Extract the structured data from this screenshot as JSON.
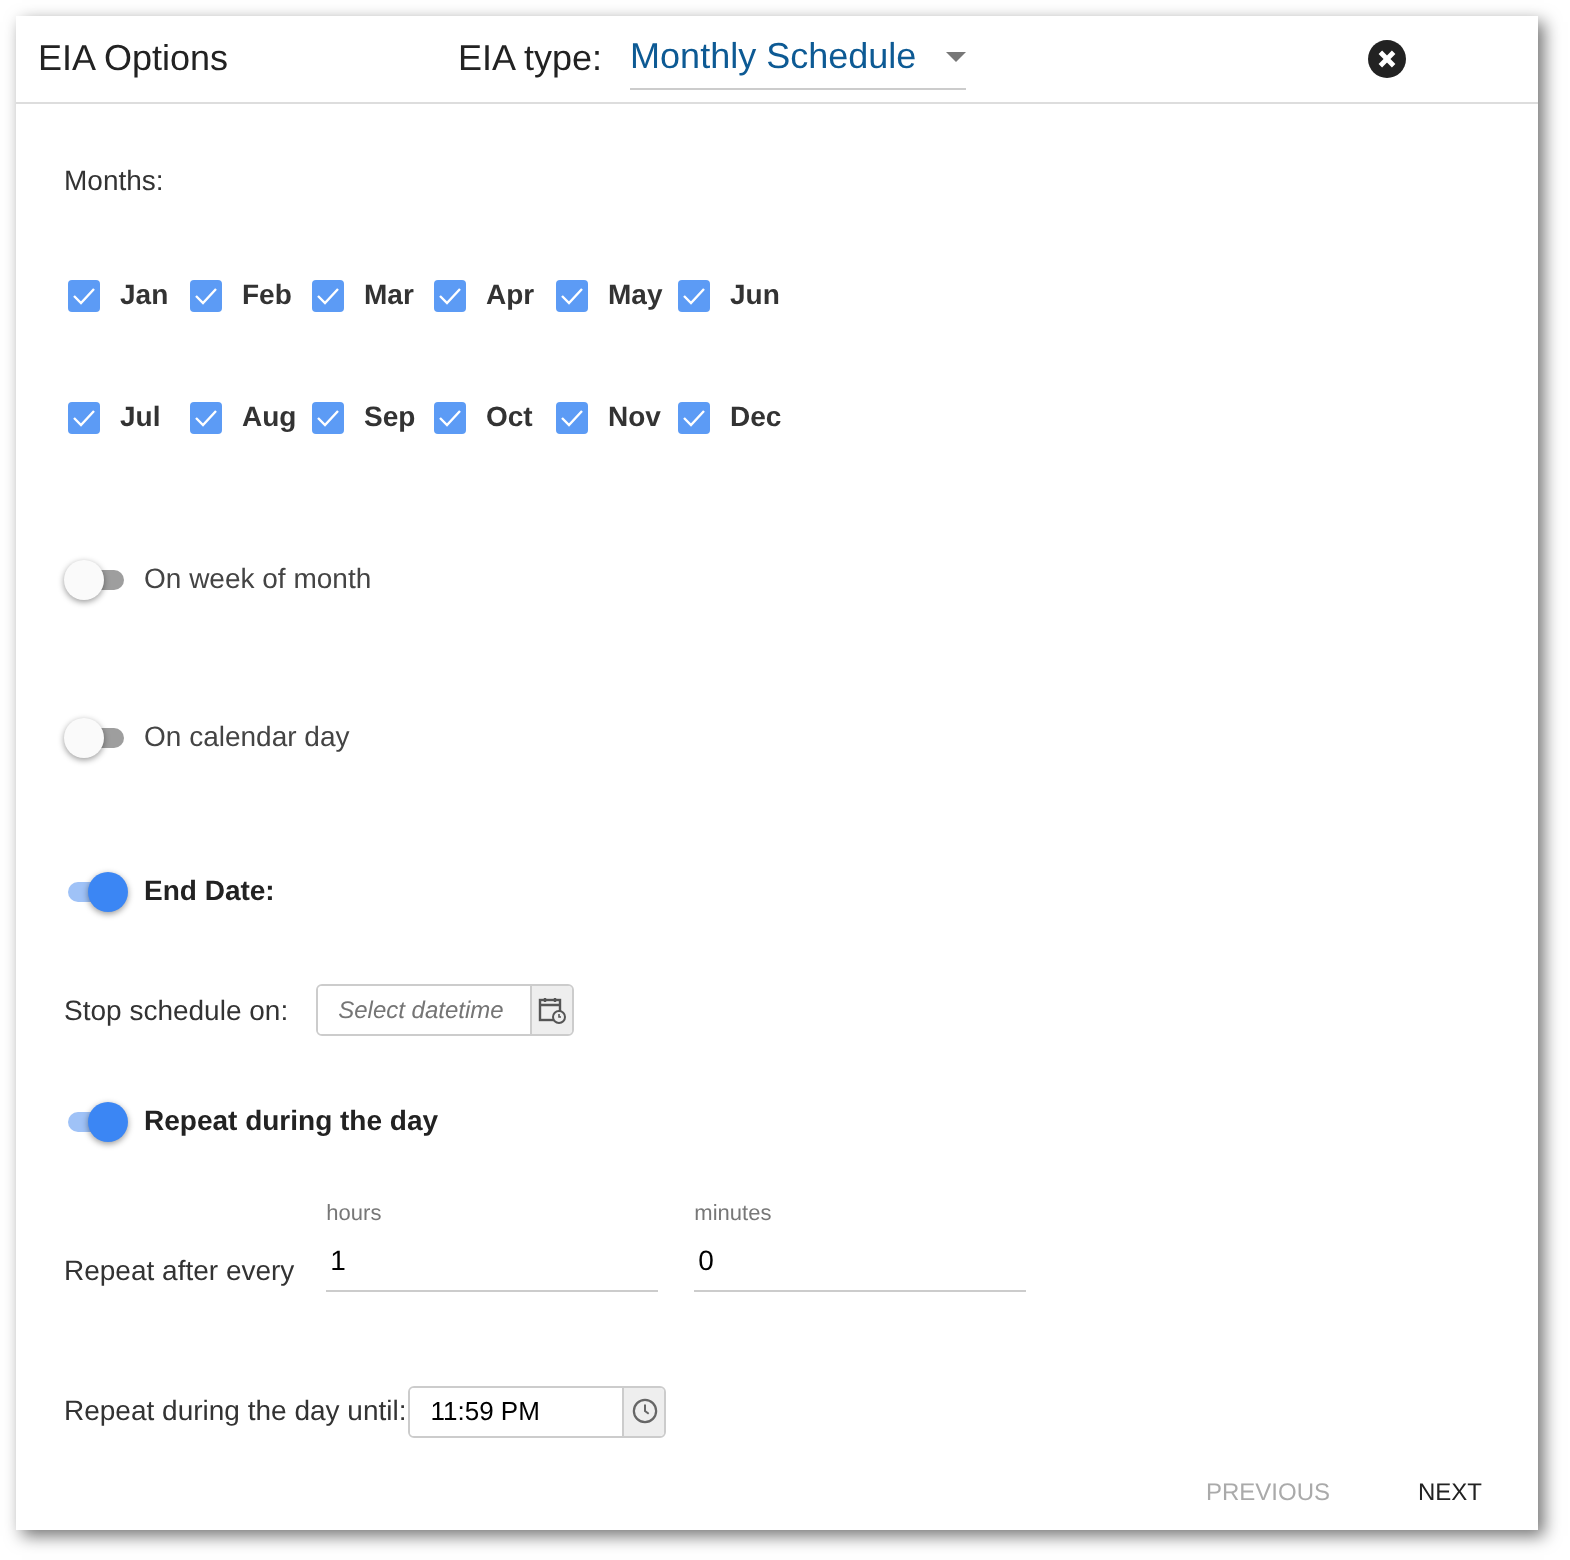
{
  "dialog": {
    "title": "EIA Options",
    "type_label": "EIA type:",
    "type_value": "Monthly Schedule"
  },
  "months_label": "Months:",
  "months": [
    {
      "label": "Jan",
      "checked": true
    },
    {
      "label": "Feb",
      "checked": true
    },
    {
      "label": "Mar",
      "checked": true
    },
    {
      "label": "Apr",
      "checked": true
    },
    {
      "label": "May",
      "checked": true
    },
    {
      "label": "Jun",
      "checked": true
    },
    {
      "label": "Jul",
      "checked": true
    },
    {
      "label": "Aug",
      "checked": true
    },
    {
      "label": "Sep",
      "checked": true
    },
    {
      "label": "Oct",
      "checked": true
    },
    {
      "label": "Nov",
      "checked": true
    },
    {
      "label": "Dec",
      "checked": true
    }
  ],
  "week_of_month": {
    "label": "On week of month",
    "on": false
  },
  "calendar_day": {
    "label": "On calendar day",
    "on": false
  },
  "end_date": {
    "label": "End Date:",
    "on": true
  },
  "stop_schedule": {
    "label": "Stop schedule on:",
    "placeholder": "Select datetime"
  },
  "repeat": {
    "label": "Repeat during the day",
    "on": true
  },
  "repeat_every": {
    "label": "Repeat after every",
    "hours_label": "hours",
    "hours_value": "1",
    "minutes_label": "minutes",
    "minutes_value": "0"
  },
  "until": {
    "label": "Repeat during the day until:",
    "value": "11:59 PM"
  },
  "buttons": [
    {
      "label": "PREVIOUS",
      "disabled": true
    },
    {
      "label": "NEXT",
      "disabled": false
    }
  ]
}
